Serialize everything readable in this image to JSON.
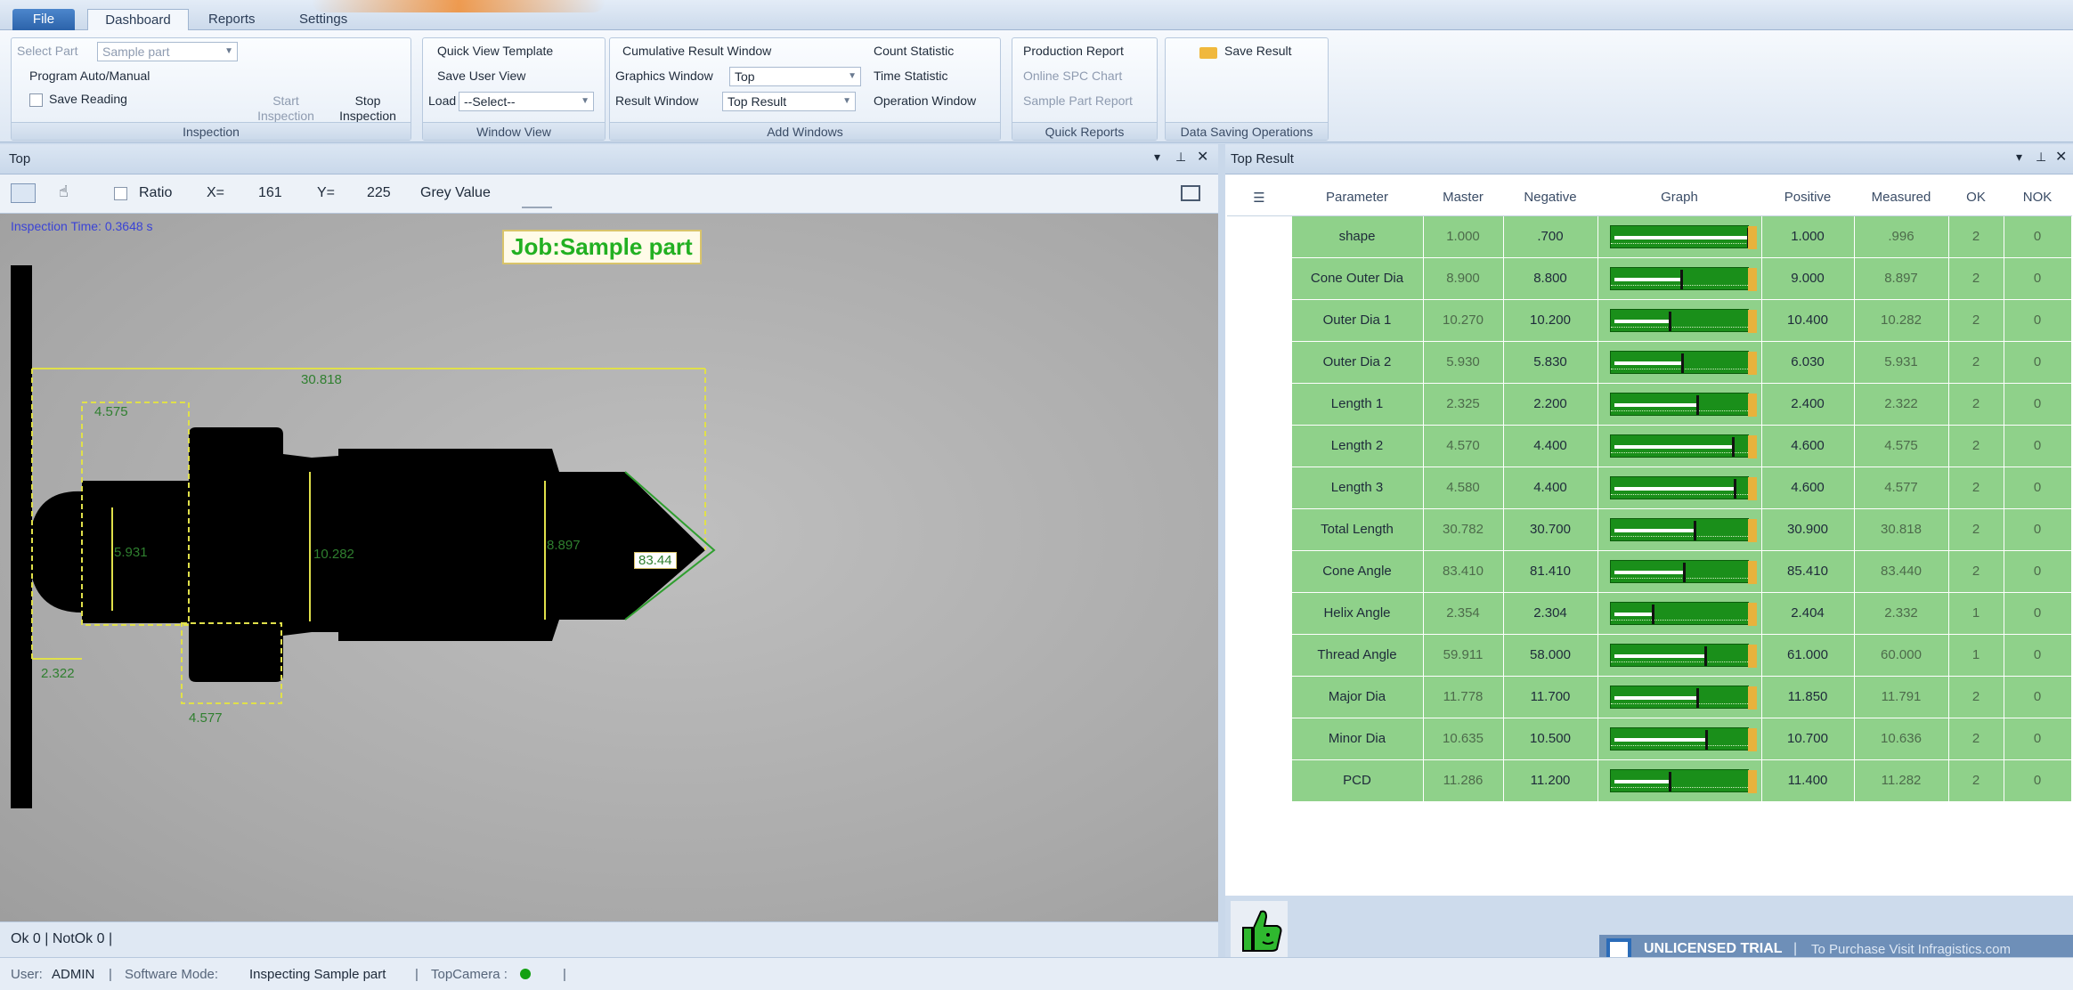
{
  "tabs": {
    "file": "File",
    "dashboard": "Dashboard",
    "reports": "Reports",
    "settings": "Settings"
  },
  "ribbon": {
    "inspection": {
      "select_part_label": "Select Part",
      "select_part_value": "Sample part",
      "program": "Program Auto/Manual",
      "save_reading": "Save Reading",
      "start": [
        "Start",
        "Inspection"
      ],
      "stop": [
        "Stop",
        "Inspection"
      ],
      "caption": "Inspection"
    },
    "window_view": {
      "quick_view": "Quick View Template",
      "save_user": "Save User View",
      "load_label": "Load",
      "load_value": "--Select--",
      "caption": "Window View"
    },
    "add_windows": {
      "cumulative": "Cumulative Result Window",
      "graphics_label": "Graphics Window",
      "graphics_value": "Top",
      "result_label": "Result Window",
      "result_value": "Top Result",
      "count": "Count Statistic",
      "time": "Time Statistic",
      "operation": "Operation Window",
      "caption": "Add Windows"
    },
    "quick_reports": {
      "production": "Production Report",
      "online_spc": "Online SPC Chart",
      "sample_part": "Sample Part Report",
      "caption": "Quick Reports"
    },
    "data_saving": {
      "save_result": "Save Result",
      "caption": "Data Saving Operations"
    }
  },
  "left": {
    "title": "Top",
    "ratio": "Ratio",
    "x_label": "X=",
    "x_value": "161",
    "y_label": "Y=",
    "y_value": "225",
    "grey": "Grey Value",
    "inspection_time": "Inspection Time: 0.3648 s",
    "job": "Job:Sample part",
    "dims": {
      "total": "30.818",
      "a": "4.575",
      "b": "5.931",
      "c": "10.282",
      "d": "8.897",
      "angle": "83.44",
      "e": "2.322",
      "f": "4.577"
    },
    "status": "Ok 0  |  NotOk 0  |"
  },
  "right": {
    "title": "Top Result",
    "headers": [
      "Parameter",
      "Master",
      "Negative",
      "Graph",
      "Positive",
      "Measured",
      "OK",
      "NOK"
    ],
    "rows": [
      {
        "p": "shape",
        "m": "1.000",
        "n": ".700",
        "pos": "1.000",
        "meas": ".996",
        "ok": "2",
        "nok": "0",
        "mk": 0.99
      },
      {
        "p": "Cone Outer Dia",
        "m": "8.900",
        "n": "8.800",
        "pos": "9.000",
        "meas": "8.897",
        "ok": "2",
        "nok": "0",
        "mk": 0.49
      },
      {
        "p": "Outer Dia 1",
        "m": "10.270",
        "n": "10.200",
        "pos": "10.400",
        "meas": "10.282",
        "ok": "2",
        "nok": "0",
        "mk": 0.41
      },
      {
        "p": "Outer Dia 2",
        "m": "5.930",
        "n": "5.830",
        "pos": "6.030",
        "meas": "5.931",
        "ok": "2",
        "nok": "0",
        "mk": 0.5
      },
      {
        "p": "Length 1",
        "m": "2.325",
        "n": "2.200",
        "pos": "2.400",
        "meas": "2.322",
        "ok": "2",
        "nok": "0",
        "mk": 0.61
      },
      {
        "p": "Length 2",
        "m": "4.570",
        "n": "4.400",
        "pos": "4.600",
        "meas": "4.575",
        "ok": "2",
        "nok": "0",
        "mk": 0.88
      },
      {
        "p": "Length 3",
        "m": "4.580",
        "n": "4.400",
        "pos": "4.600",
        "meas": "4.577",
        "ok": "2",
        "nok": "0",
        "mk": 0.89
      },
      {
        "p": "Total Length",
        "m": "30.782",
        "n": "30.700",
        "pos": "30.900",
        "meas": "30.818",
        "ok": "2",
        "nok": "0",
        "mk": 0.59
      },
      {
        "p": "Cone Angle",
        "m": "83.410",
        "n": "81.410",
        "pos": "85.410",
        "meas": "83.440",
        "ok": "2",
        "nok": "0",
        "mk": 0.51
      },
      {
        "p": "Helix Angle",
        "m": "2.354",
        "n": "2.304",
        "pos": "2.404",
        "meas": "2.332",
        "ok": "1",
        "nok": "0",
        "mk": 0.28
      },
      {
        "p": "Thread Angle",
        "m": "59.911",
        "n": "58.000",
        "pos": "61.000",
        "meas": "60.000",
        "ok": "1",
        "nok": "0",
        "mk": 0.67
      },
      {
        "p": "Major Dia",
        "m": "11.778",
        "n": "11.700",
        "pos": "11.850",
        "meas": "11.791",
        "ok": "2",
        "nok": "0",
        "mk": 0.61
      },
      {
        "p": "Minor Dia",
        "m": "10.635",
        "n": "10.500",
        "pos": "10.700",
        "meas": "10.636",
        "ok": "2",
        "nok": "0",
        "mk": 0.68
      },
      {
        "p": "PCD",
        "m": "11.286",
        "n": "11.200",
        "pos": "11.400",
        "meas": "11.282",
        "ok": "2",
        "nok": "0",
        "mk": 0.41
      }
    ]
  },
  "trial": {
    "label": "UNLICENSED TRIAL",
    "text": "To Purchase Visit Infragistics.com"
  },
  "status": {
    "user_label": "User:",
    "user": "ADMIN",
    "mode_label": "Software Mode:",
    "mode": "Inspecting Sample part",
    "camera_label": "TopCamera :"
  },
  "colors": {
    "ok_green": "#1a8f1a",
    "row_green": "#8fd18a",
    "dim_yellow": "#e0e04a",
    "camera_dot": "#12a012"
  }
}
